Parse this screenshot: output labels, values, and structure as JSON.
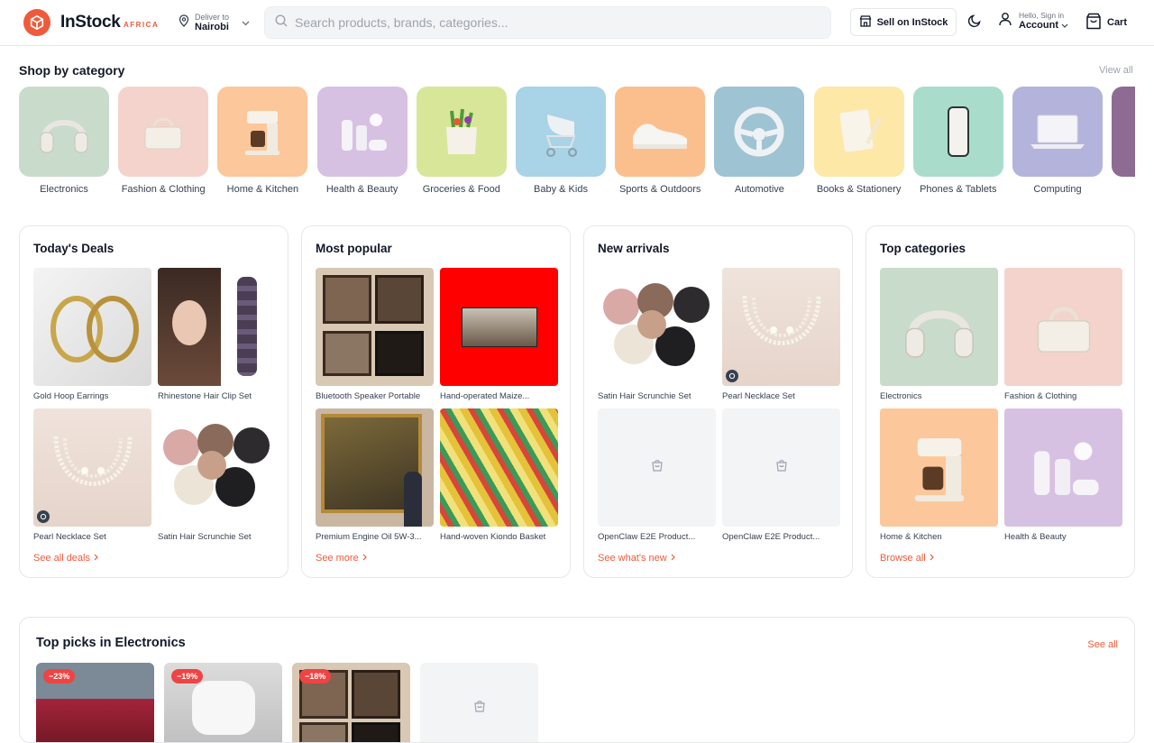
{
  "header": {
    "brand": "InStock",
    "brand_sub": "AFRICA",
    "deliver_label": "Deliver to",
    "deliver_city": "Nairobi",
    "search_placeholder": "Search products, brands, categories...",
    "sell_label": "Sell on InStock",
    "account_greeting": "Hello, Sign in",
    "account_label": "Account",
    "cart_label": "Cart"
  },
  "categories_section": {
    "title": "Shop by category",
    "view_all": "View all",
    "items": [
      {
        "label": "Electronics",
        "bg": "#c9dccb",
        "icon": "headphones"
      },
      {
        "label": "Fashion & Clothing",
        "bg": "#f4d3cc",
        "icon": "handbag"
      },
      {
        "label": "Home & Kitchen",
        "bg": "#fcc79a",
        "icon": "coffee-maker"
      },
      {
        "label": "Health & Beauty",
        "bg": "#d7c1e3",
        "icon": "cosmetics"
      },
      {
        "label": "Groceries & Food",
        "bg": "#d8e69a",
        "icon": "grocery-bag"
      },
      {
        "label": "Baby & Kids",
        "bg": "#a9d3e6",
        "icon": "stroller"
      },
      {
        "label": "Sports & Outdoors",
        "bg": "#fbbf8d",
        "icon": "sneaker"
      },
      {
        "label": "Automotive",
        "bg": "#9ec3d3",
        "icon": "steering-wheel"
      },
      {
        "label": "Books & Stationery",
        "bg": "#fde8a8",
        "icon": "notebook"
      },
      {
        "label": "Phones & Tablets",
        "bg": "#a9dccb",
        "icon": "phone"
      },
      {
        "label": "Computing",
        "bg": "#b3b3dc",
        "icon": "laptop"
      },
      {
        "label": "",
        "bg": "#8e6b93",
        "icon": "partial"
      }
    ]
  },
  "cards": [
    {
      "title": "Today's Deals",
      "link": "See all deals",
      "items": [
        {
          "caption": "Gold Hoop Earrings",
          "kind": "earrings"
        },
        {
          "caption": "Rhinestone Hair Clip Set",
          "kind": "hairclip"
        },
        {
          "caption": "Pearl Necklace Set",
          "kind": "pearls"
        },
        {
          "caption": "Satin Hair Scrunchie Set",
          "kind": "scrunchies"
        }
      ]
    },
    {
      "title": "Most popular",
      "link": "See more",
      "items": [
        {
          "caption": "Bluetooth Speaker Portable",
          "kind": "gallery"
        },
        {
          "caption": "Hand-operated Maize...",
          "kind": "red-photo"
        },
        {
          "caption": "Premium Engine Oil 5W-3...",
          "kind": "painting"
        },
        {
          "caption": "Hand-woven Kiondo Basket",
          "kind": "basket"
        }
      ]
    },
    {
      "title": "New arrivals",
      "link": "See what's new",
      "items": [
        {
          "caption": "Satin Hair Scrunchie Set",
          "kind": "scrunchies"
        },
        {
          "caption": "Pearl Necklace Set",
          "kind": "pearls"
        },
        {
          "caption": "OpenClaw E2E Product...",
          "kind": "placeholder"
        },
        {
          "caption": "OpenClaw E2E Product...",
          "kind": "placeholder"
        }
      ]
    },
    {
      "title": "Top categories",
      "link": "Browse all",
      "items": [
        {
          "caption": "Electronics",
          "kind": "cat-electronics"
        },
        {
          "caption": "Fashion & Clothing",
          "kind": "cat-fashion"
        },
        {
          "caption": "Home & Kitchen",
          "kind": "cat-home"
        },
        {
          "caption": "Health & Beauty",
          "kind": "cat-beauty"
        }
      ]
    }
  ],
  "picks": {
    "title": "Top picks in Electronics",
    "see_all": "See all",
    "items": [
      {
        "discount": "−23%",
        "kind": "car"
      },
      {
        "discount": "−19%",
        "kind": "earbuds"
      },
      {
        "discount": "−18%",
        "kind": "gallery"
      },
      {
        "discount": "",
        "kind": "placeholder"
      }
    ]
  },
  "colors": {
    "accent": "#ef5a3c",
    "border": "#e5e7eb",
    "muted": "#9ca3af"
  }
}
